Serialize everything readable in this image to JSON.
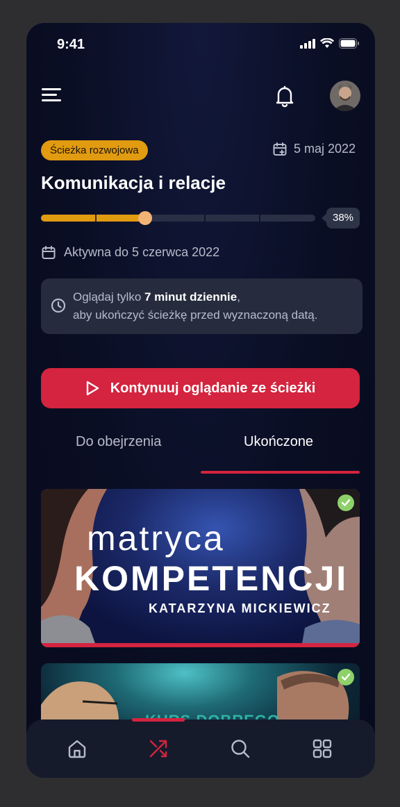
{
  "status_bar": {
    "time": "9:41"
  },
  "path": {
    "tag": "Ścieżka rozwojowa",
    "date": "5 maj 2022",
    "title": "Komunikacja i relacje",
    "progress_percent": 38,
    "progress_label": "38%",
    "active_until": "Aktywna do 5 czerwca 2022"
  },
  "info": {
    "line1_prefix": "Oglądaj tylko ",
    "line1_bold": "7 minut dziennie",
    "line1_suffix": ",",
    "line2": "aby ukończyć ścieżkę przed wyznaczoną datą."
  },
  "cta": {
    "label": "Kontynuuj oglądanie ze ścieżki"
  },
  "tabs": [
    {
      "label": "Do obejrzenia",
      "active": false
    },
    {
      "label": "Ukończone",
      "active": true
    }
  ],
  "courses": [
    {
      "line1": "matryca",
      "line2": "KOMPETENCJI",
      "author": "KATARZYNA MICKIEWICZ",
      "completed": true
    },
    {
      "title_partial": "KURS DOBREGO",
      "completed": true
    }
  ],
  "bottom_nav": [
    {
      "icon": "home-icon",
      "active": false
    },
    {
      "icon": "paths-icon",
      "active": true
    },
    {
      "icon": "search-icon",
      "active": false
    },
    {
      "icon": "grid-icon",
      "active": false
    }
  ],
  "colors": {
    "accent_red": "#d4243f",
    "accent_orange": "#e19b10",
    "check_green": "#8ed16a",
    "background": "#0a0e24"
  }
}
